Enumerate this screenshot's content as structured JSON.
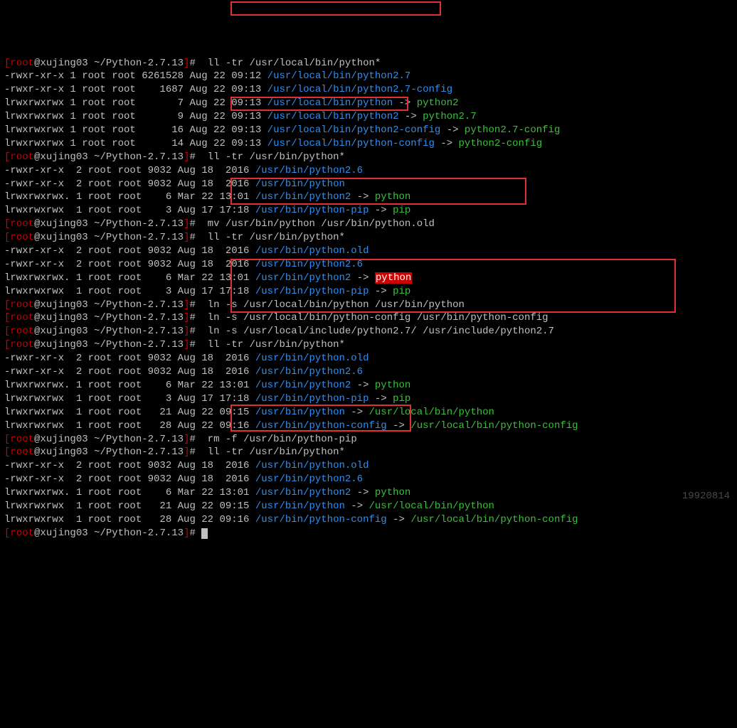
{
  "prompt": {
    "user": "root",
    "host": "xujing03",
    "path": "~/Python-2.7.13"
  },
  "commands": {
    "c1": "ll -tr /usr/local/bin/python*",
    "c2": "ll -tr /usr/bin/python*",
    "c3a": "mv /usr/bin/python /usr/bin/python.old",
    "c3b": "ll -tr /usr/bin/python*",
    "c4a": "ln -s /usr/local/bin/python /usr/bin/python",
    "c4b": "ln -s /usr/local/bin/python-config /usr/bin/python-config",
    "c4c": "ln -s /usr/local/include/python2.7/ /usr/include/python2.7",
    "c4d": "ll -tr /usr/bin/python*",
    "c5a": "rm -f /usr/bin/python-pip",
    "c5b": "ll -tr /usr/bin/python*"
  },
  "out1": [
    {
      "perm": "-rwxr-xr-x 1 root root 6261528 Aug 22 09:12 ",
      "file": "/usr/local/bin/python2.7"
    },
    {
      "perm": "-rwxr-xr-x 1 root root    1687 Aug 22 09:13 ",
      "file": "/usr/local/bin/python2.7-config"
    },
    {
      "perm": "lrwxrwxrwx 1 root root       7 Aug 22 09:13 ",
      "file": "/usr/local/bin/python",
      "target": "python2"
    },
    {
      "perm": "lrwxrwxrwx 1 root root       9 Aug 22 09:13 ",
      "file": "/usr/local/bin/python2",
      "target": "python2.7"
    },
    {
      "perm": "lrwxrwxrwx 1 root root      16 Aug 22 09:13 ",
      "file": "/usr/local/bin/python2-config",
      "target": "python2.7-config"
    },
    {
      "perm": "lrwxrwxrwx 1 root root      14 Aug 22 09:13 ",
      "file": "/usr/local/bin/python-config",
      "target": "python2-config"
    }
  ],
  "out2": [
    {
      "perm": "-rwxr-xr-x  2 root root 9032 Aug 18  2016 ",
      "file": "/usr/bin/python2.6"
    },
    {
      "perm": "-rwxr-xr-x  2 root root 9032 Aug 18  2016 ",
      "file": "/usr/bin/python"
    },
    {
      "perm": "lrwxrwxrwx. 1 root root    6 Mar 22 13:01 ",
      "file": "/usr/bin/python2",
      "target": "python"
    },
    {
      "perm": "lrwxrwxrwx  1 root root    3 Aug 17 17:18 ",
      "file": "/usr/bin/python-pip",
      "target": "pip"
    }
  ],
  "out3": [
    {
      "perm": "-rwxr-xr-x  2 root root 9032 Aug 18  2016 ",
      "file": "/usr/bin/python.old"
    },
    {
      "perm": "-rwxr-xr-x  2 root root 9032 Aug 18  2016 ",
      "file": "/usr/bin/python2.6"
    },
    {
      "perm": "lrwxrwxrwx. 1 root root    6 Mar 22 13:01 ",
      "file": "/usr/bin/python2",
      "target": "python",
      "tred": true
    },
    {
      "perm": "lrwxrwxrwx  1 root root    3 Aug 17 17:18 ",
      "file": "/usr/bin/python-pip",
      "target": "pip"
    }
  ],
  "out4": [
    {
      "perm": "-rwxr-xr-x  2 root root 9032 Aug 18  2016 ",
      "file": "/usr/bin/python.old"
    },
    {
      "perm": "-rwxr-xr-x  2 root root 9032 Aug 18  2016 ",
      "file": "/usr/bin/python2.6"
    },
    {
      "perm": "lrwxrwxrwx. 1 root root    6 Mar 22 13:01 ",
      "file": "/usr/bin/python2",
      "target": "python"
    },
    {
      "perm": "lrwxrwxrwx  1 root root    3 Aug 17 17:18 ",
      "file": "/usr/bin/python-pip",
      "target": "pip"
    },
    {
      "perm": "lrwxrwxrwx  1 root root   21 Aug 22 09:15 ",
      "file": "/usr/bin/python",
      "target": "/usr/local/bin/python"
    },
    {
      "perm": "lrwxrwxrwx  1 root root   28 Aug 22 09:16 ",
      "file": "/usr/bin/python-config",
      "target": "/usr/local/bin/python-config"
    }
  ],
  "out5": [
    {
      "perm": "-rwxr-xr-x  2 root root 9032 Aug 18  2016 ",
      "file": "/usr/bin/python.old"
    },
    {
      "perm": "-rwxr-xr-x  2 root root 9032 Aug 18  2016 ",
      "file": "/usr/bin/python2.6"
    },
    {
      "perm": "lrwxrwxrwx. 1 root root    6 Mar 22 13:01 ",
      "file": "/usr/bin/python2",
      "target": "python"
    },
    {
      "perm": "lrwxrwxrwx  1 root root   21 Aug 22 09:15 ",
      "file": "/usr/bin/python",
      "target": "/usr/local/bin/python"
    },
    {
      "perm": "lrwxrwxrwx  1 root root   28 Aug 22 09:16 ",
      "file": "/usr/bin/python-config",
      "target": "/usr/local/bin/python-config"
    }
  ],
  "watermark": "19920814"
}
